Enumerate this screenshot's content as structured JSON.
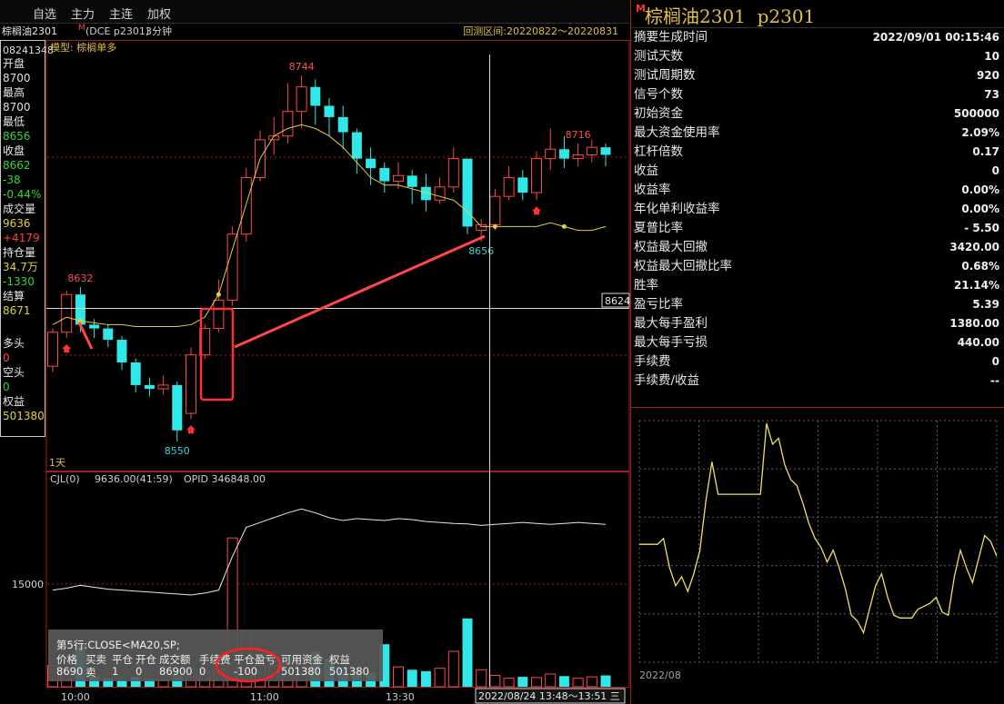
{
  "toolbar": {
    "items": [
      "自选",
      "主力",
      "主连",
      "加权"
    ]
  },
  "chart_header": {
    "symbol": "棕榈油2301",
    "badge": "M",
    "exchange": "(DCE p2301)",
    "period": "3分钟",
    "range_label": "回测区间:20220822～20220831"
  },
  "left_panel": {
    "date": "08241348",
    "rows": [
      {
        "label": "开盘",
        "value": "8700",
        "value_color": "#e0e0e0"
      },
      {
        "label": "最高",
        "value": "8700",
        "value_color": "#e0e0e0"
      },
      {
        "label": "最低",
        "value": "8656",
        "value_color": "#33d633"
      },
      {
        "label": "收盘",
        "value": "8662",
        "value_color": "#33d633"
      },
      {
        "label": "",
        "value": "-38",
        "value_color": "#33d633"
      },
      {
        "label": "",
        "value": "-0.44%",
        "value_color": "#33d633"
      },
      {
        "label": "成交量",
        "value": "9636",
        "value_color": "#e0d040"
      },
      {
        "label": "",
        "value": "+4179",
        "value_color": "#ff4040"
      },
      {
        "label": "持仓量",
        "value": "34.7万",
        "value_color": "#e0d040"
      },
      {
        "label": "",
        "value": "-1330",
        "value_color": "#33d633"
      },
      {
        "label": "结算",
        "value": "8671",
        "value_color": "#e0d040"
      }
    ],
    "position_rows": [
      {
        "label": "多头",
        "value": "0",
        "value_color": "#ff4040"
      },
      {
        "label": "空头",
        "value": "0",
        "value_color": "#33d633"
      },
      {
        "label": "权益",
        "value": "501380",
        "value_color": "#e0d040"
      }
    ]
  },
  "main_chart": {
    "model_label": "模型: 棕榈单多",
    "period_tag": "1天",
    "crosshair_price": "8624",
    "crosshair_time": "2022/08/24 13:48～13:51 三",
    "x_labels": [
      "10:00",
      "11:00",
      "13:30"
    ]
  },
  "volume_chart": {
    "header_name": "CJL(0)",
    "header_value": "9636.00(41:59)",
    "header_opid": "OPID 346848.00",
    "y_label": "15000"
  },
  "trade_popup": {
    "title": "第5行:CLOSE<MA20,SP;",
    "columns": [
      "价格",
      "买卖",
      "平仓",
      "开仓",
      "成交额",
      "手续费",
      "平仓盈亏",
      "可用资金",
      "权益"
    ],
    "values": [
      "8690",
      "卖",
      "1",
      "0",
      "86900",
      "0",
      "-100",
      "501380",
      "501380"
    ]
  },
  "right_panel": {
    "badge": "M",
    "title": "棕榈油2301  p2301",
    "stats": [
      {
        "label": "摘要生成时间",
        "value": "2022/09/01 00:15:46"
      },
      {
        "label": "测试天数",
        "value": "10"
      },
      {
        "label": "测试周期数",
        "value": "920"
      },
      {
        "label": "信号个数",
        "value": "73"
      },
      {
        "label": "初始资金",
        "value": "500000"
      },
      {
        "label": "最大资金使用率",
        "value": "2.09%"
      },
      {
        "label": "杠杆倍数",
        "value": "0.17"
      },
      {
        "label": "收益",
        "value": "0"
      },
      {
        "label": "收益率",
        "value": "0.00%"
      },
      {
        "label": "年化单利收益率",
        "value": "0.00%"
      },
      {
        "label": "夏普比率",
        "value": "- 5.50"
      },
      {
        "label": "权益最大回撤",
        "value": "3420.00"
      },
      {
        "label": "权益最大回撤比率",
        "value": "0.68%"
      },
      {
        "label": "胜率",
        "value": "21.14%"
      },
      {
        "label": "盈亏比率",
        "value": "5.39"
      },
      {
        "label": "最大每手盈利",
        "value": "1380.00"
      },
      {
        "label": "最大每手亏损",
        "value": "440.00"
      },
      {
        "label": "手续费",
        "value": "0"
      },
      {
        "label": "手续费/收益",
        "value": "--"
      }
    ],
    "equity_date": "2022/08"
  },
  "chart_data": [
    {
      "type": "candlestick",
      "name": "",
      "ylim": [
        8540,
        8760
      ],
      "price_labels": [
        {
          "value": 8744,
          "text": "8744",
          "color": "#ff5050"
        },
        {
          "value": 8716,
          "text": "8716",
          "color": "#ff5050"
        },
        {
          "value": 8632,
          "text": "8632",
          "color": "#ff5050"
        },
        {
          "value": 8656,
          "text": "8656",
          "color": "#40d0d0"
        },
        {
          "value": 8550,
          "text": "8550",
          "color": "#40d0d0"
        }
      ],
      "candles": [
        [
          8590,
          8608,
          8587,
          8610
        ],
        [
          8608,
          8628,
          8605,
          8630
        ],
        [
          8628,
          8612,
          8608,
          8632
        ],
        [
          8612,
          8610,
          8605,
          8615
        ],
        [
          8610,
          8604,
          8600,
          8612
        ],
        [
          8604,
          8592,
          8588,
          8606
        ],
        [
          8592,
          8580,
          8576,
          8594
        ],
        [
          8580,
          8578,
          8574,
          8584
        ],
        [
          8578,
          8580,
          8575,
          8585
        ],
        [
          8580,
          8556,
          8550,
          8582
        ],
        [
          8565,
          8596,
          8562,
          8600
        ],
        [
          8596,
          8610,
          8594,
          8612
        ],
        [
          8610,
          8625,
          8608,
          8636
        ],
        [
          8625,
          8660,
          8622,
          8664
        ],
        [
          8660,
          8690,
          8656,
          8695
        ],
        [
          8690,
          8710,
          8688,
          8715
        ],
        [
          8710,
          8712,
          8702,
          8722
        ],
        [
          8712,
          8725,
          8708,
          8740
        ],
        [
          8725,
          8738,
          8716,
          8744
        ],
        [
          8738,
          8728,
          8718,
          8742
        ],
        [
          8728,
          8722,
          8712,
          8732
        ],
        [
          8722,
          8714,
          8705,
          8728
        ],
        [
          8714,
          8700,
          8692,
          8716
        ],
        [
          8700,
          8695,
          8686,
          8706
        ],
        [
          8695,
          8688,
          8682,
          8698
        ],
        [
          8688,
          8691,
          8684,
          8698
        ],
        [
          8691,
          8685,
          8676,
          8694
        ],
        [
          8685,
          8678,
          8672,
          8692
        ],
        [
          8678,
          8685,
          8676,
          8690
        ],
        [
          8685,
          8700,
          8682,
          8706
        ],
        [
          8700,
          8664,
          8660,
          8700
        ],
        [
          8662,
          8665,
          8656,
          8668
        ],
        [
          8665,
          8680,
          8662,
          8684
        ],
        [
          8680,
          8690,
          8678,
          8696
        ],
        [
          8690,
          8682,
          8678,
          8694
        ],
        [
          8682,
          8700,
          8678,
          8704
        ],
        [
          8700,
          8705,
          8694,
          8716
        ],
        [
          8705,
          8700,
          8695,
          8712
        ],
        [
          8700,
          8702,
          8696,
          8708
        ],
        [
          8702,
          8706,
          8698,
          8710
        ],
        [
          8706,
          8702,
          8696,
          8708
        ]
      ],
      "ma": [
        8612,
        8616,
        8614,
        8613,
        8612,
        8612,
        8611,
        8611,
        8611,
        8611,
        8612,
        8616,
        8628,
        8652,
        8676,
        8700,
        8712,
        8716,
        8718,
        8716,
        8712,
        8706,
        8698,
        8690,
        8686,
        8686,
        8684,
        8682,
        8680,
        8678,
        8672,
        8664,
        8664,
        8664,
        8664,
        8664,
        8666,
        8664,
        8662,
        8662,
        8664
      ],
      "signals": [
        1,
        10,
        35
      ]
    },
    {
      "type": "bar",
      "name": "CJL",
      "ylim": [
        0,
        30000
      ],
      "values": [
        3000,
        1800,
        6000,
        1500,
        1200,
        900,
        1400,
        1100,
        1000,
        1600,
        1400,
        2200,
        3200,
        21000,
        7500,
        3000,
        3000,
        5000,
        4500,
        5000,
        4000,
        2600,
        2200,
        2000,
        6000,
        2800,
        2400,
        2200,
        2600,
        5000,
        9636,
        2400,
        1600,
        1200,
        1400,
        1300,
        1800,
        1500,
        1200,
        1400,
        1600
      ],
      "opid": [
        340000,
        340200,
        340500,
        340300,
        340100,
        340000,
        339900,
        339800,
        339700,
        339600,
        339500,
        339700,
        340000,
        343500,
        346500,
        347000,
        347500,
        348000,
        348400,
        348000,
        347500,
        347200,
        347400,
        347300,
        347200,
        347400,
        347300,
        347100,
        347000,
        346900,
        346848,
        346700,
        346800,
        346900,
        347000,
        346900,
        346800,
        346900,
        347000,
        346900,
        346800
      ],
      "opid_ylim": [
        330000,
        352000
      ]
    },
    {
      "type": "line",
      "name": "",
      "ylim": [
        496000,
        504200
      ],
      "x_label": "2022/08",
      "values": [
        500000,
        500000,
        500000,
        500000,
        500200,
        499200,
        498600,
        498900,
        498400,
        499000,
        499800,
        501500,
        502800,
        501700,
        501700,
        501700,
        501700,
        501700,
        501700,
        501700,
        501700,
        504100,
        503400,
        503600,
        502700,
        502200,
        502000,
        501400,
        500700,
        500200,
        499900,
        499400,
        499800,
        499200,
        498500,
        497600,
        497400,
        497000,
        497800,
        498600,
        499000,
        498200,
        497600,
        497500,
        497500,
        497500,
        497800,
        497900,
        498000,
        498200,
        497700,
        497600,
        498900,
        499800,
        499200,
        498700,
        499500,
        500300,
        500100,
        499600
      ]
    }
  ]
}
